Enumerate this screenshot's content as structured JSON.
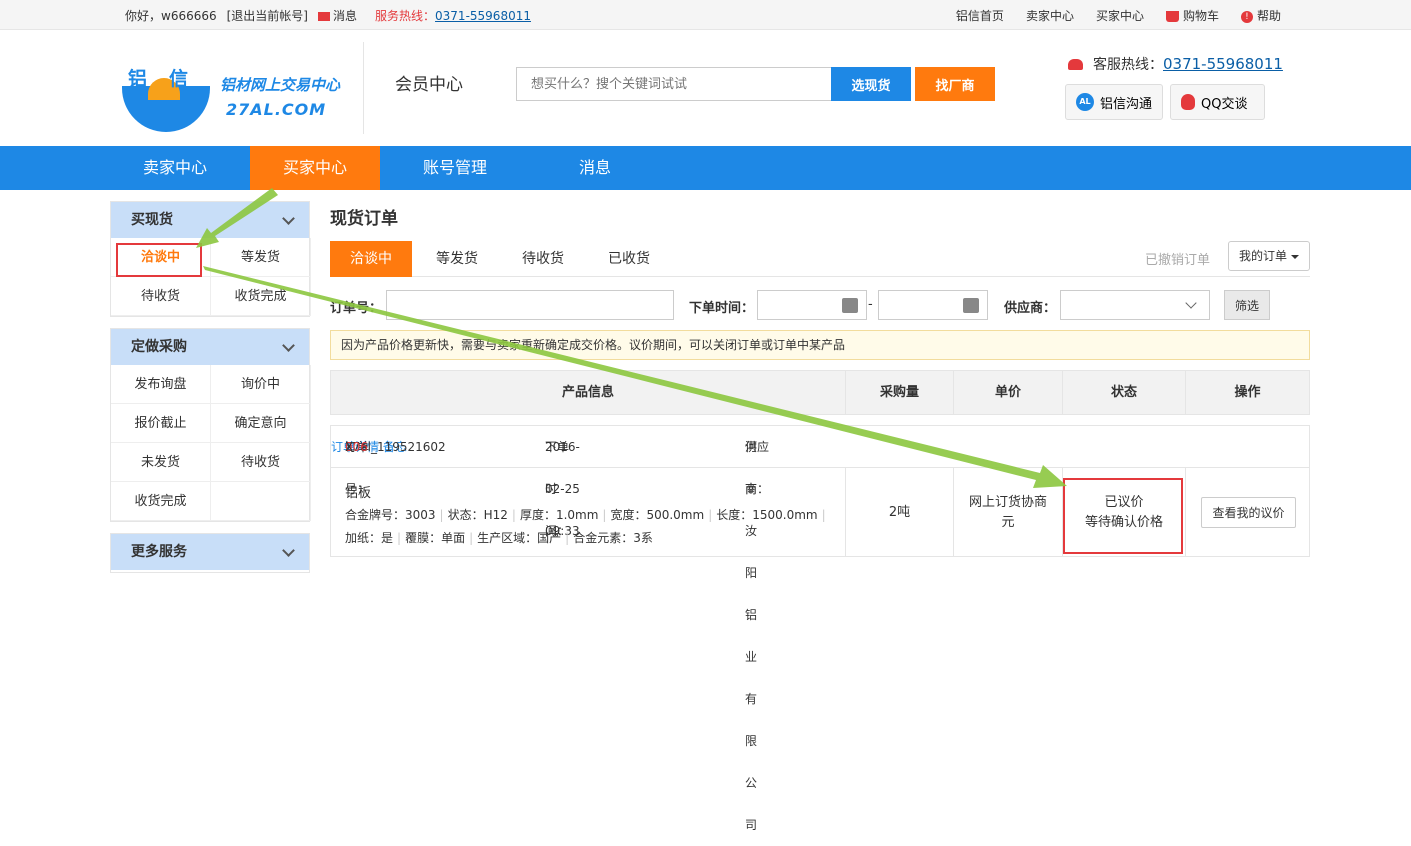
{
  "topbar": {
    "greeting": "你好，w666666",
    "logout": "[退出当前帐号]",
    "messages": "消息",
    "hotline_label": "服务热线：",
    "hotline_number": "0371-55968011",
    "links": [
      "铝信首页",
      "卖家中心",
      "买家中心"
    ],
    "cart": "购物车",
    "help": "帮助"
  },
  "header": {
    "logo_cn": "铝信",
    "logo_name": "铝材网上交易中心",
    "logo_domain": "27AL.COM",
    "member_center": "会员中心",
    "search_placeholder": "想买什么？搜个关键词试试",
    "btn_spot": "选现货",
    "btn_factory": "找厂商",
    "service_label": "客服热线：",
    "service_number": "0371-55968011",
    "chat_al_icon": "AL",
    "chat_al": "铝信沟通",
    "chat_qq": "QQ交谈"
  },
  "nav": [
    "卖家中心",
    "买家中心",
    "账号管理",
    "消息"
  ],
  "sidebar": {
    "buy_spot": {
      "title": "买现货",
      "items": [
        "洽谈中",
        "等发货",
        "待收货",
        "收货完成"
      ]
    },
    "custom": {
      "title": "定做采购",
      "items": [
        "发布询盘",
        "询价中",
        "报价截止",
        "确定意向",
        "未发货",
        "待收货",
        "收货完成"
      ]
    },
    "more": {
      "title": "更多服务"
    }
  },
  "main": {
    "title": "现货订单",
    "tabs": [
      "洽谈中",
      "等发货",
      "待收货",
      "已收货"
    ],
    "cancelled": "已撤销订单",
    "my_orders": "我的订单",
    "filter": {
      "order_no_label": "订单号：",
      "order_time_label": "下单时间：",
      "dash": "-",
      "supplier_label": "供应商：",
      "btn": "筛选"
    },
    "notice": "因为产品价格更新快，需要与卖家重新确定成交价格。议价期间，可以关闭订单或订单中某产品",
    "table_headers": [
      "产品信息",
      "采购量",
      "单价",
      "状态",
      "操作"
    ],
    "order": {
      "no_label": "订单号：",
      "no_prefix": "27al_119521602",
      "no_red": "006",
      "no_suffix": "X",
      "time_label": "下单时间：",
      "time": "2016-02-25 09:33",
      "supplier_label": "供应商：",
      "supplier": "河南汝阳铝业有限公司",
      "detail_link": "订单详情",
      "memo_link": "备忘",
      "product": "铝板",
      "spec_line1": [
        "合金牌号：3003",
        "状态：H12",
        "厚度：1.0mm",
        "宽度：500.0mm",
        "长度：1500.0mm"
      ],
      "spec_line2": [
        "加纸：是",
        "覆膜：单面",
        "生产区域：国产",
        "合金元素：3系"
      ],
      "quantity": "2吨",
      "price_line1": "网上订货协商",
      "price_line2": "元",
      "status_line1": "已议价",
      "status_line2": "等待确认价格",
      "action": "查看我的议价"
    }
  }
}
